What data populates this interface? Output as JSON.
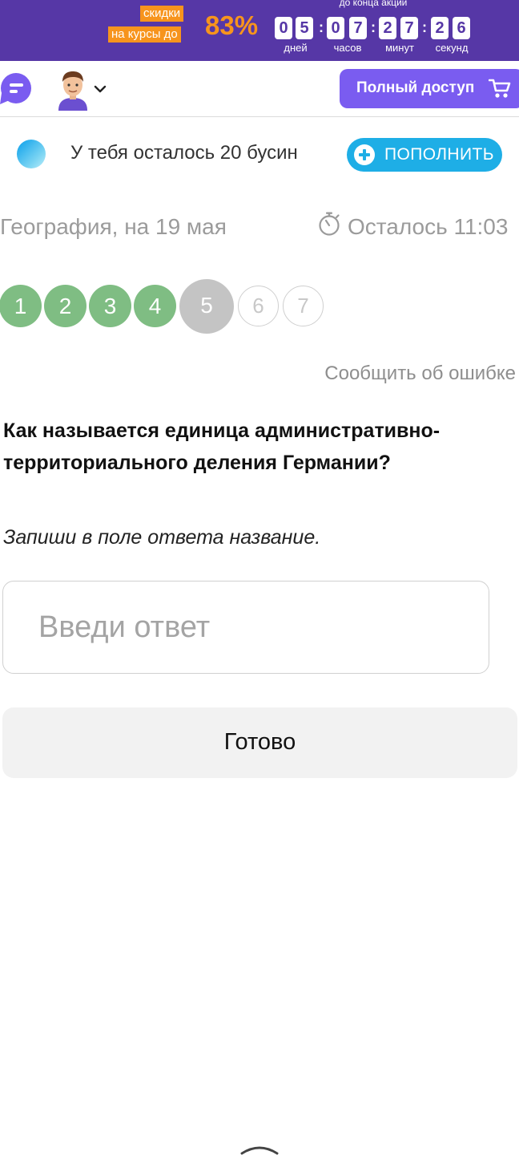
{
  "promo": {
    "label_line1": "скидки",
    "label_line2": "на курсы до",
    "percent": "83%",
    "until_text": "до конца акции",
    "timer": {
      "days": [
        "0",
        "5"
      ],
      "hours": [
        "0",
        "7"
      ],
      "minutes": [
        "2",
        "7"
      ],
      "seconds": [
        "2",
        "6"
      ],
      "separator": ":",
      "units": [
        "дней",
        "часов",
        "минут",
        "секунд"
      ]
    },
    "colors": {
      "background": "#5637a6",
      "accent": "#f7941d"
    }
  },
  "header": {
    "chat_icon": "chat-bubble-icon",
    "avatar_icon": "user-avatar-icon",
    "menu_icon": "chevron-down-icon",
    "full_access_label": "Полный доступ",
    "cart_icon": "cart-icon",
    "colors": {
      "full_access": "#7a5cf0"
    }
  },
  "beads": {
    "icon": "bead-icon",
    "text": "У тебя осталось 20 бусин",
    "topup_label": "ПОПОЛНИТЬ",
    "topup_icon": "plus-circle-icon",
    "colors": {
      "topup": "#1eaee6"
    }
  },
  "test": {
    "subject": "География, на 19 мая",
    "timer_icon": "stopwatch-icon",
    "time_left": "Осталось 11:03",
    "steps": [
      {
        "label": "1",
        "state": "done"
      },
      {
        "label": "2",
        "state": "done"
      },
      {
        "label": "3",
        "state": "done"
      },
      {
        "label": "4",
        "state": "done"
      },
      {
        "label": "5",
        "state": "current"
      },
      {
        "label": "6",
        "state": "todo"
      },
      {
        "label": "7",
        "state": "todo"
      }
    ],
    "step_colors": {
      "done": "#7fbd83",
      "current": "#c4c4c4",
      "todo": "#ffffff"
    },
    "report_error": "Сообщить об ошибке"
  },
  "question": {
    "text": "Как называется единица административно-территориального деления Германии?",
    "instruction": "Запиши в поле ответа название.",
    "answer_value": "",
    "answer_placeholder": "Введи ответ",
    "submit_label": "Готово"
  },
  "footer": {
    "scroll_icon": "chevron-up-icon"
  }
}
